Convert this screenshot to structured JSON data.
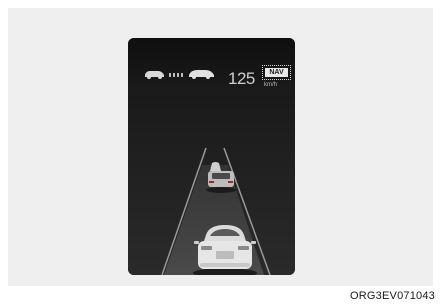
{
  "hud": {
    "set_speed": "125",
    "speed_unit": "km/h",
    "nav_badge": "NAV",
    "icons": [
      "lead-vehicle-icon",
      "distance-bars-icon",
      "own-vehicle-icon"
    ]
  },
  "figure_code": "ORG3EV071043",
  "colors": {
    "screen_bg": "#121212",
    "panel_bg": "#efefef",
    "car_body": "#e6e6e6"
  }
}
